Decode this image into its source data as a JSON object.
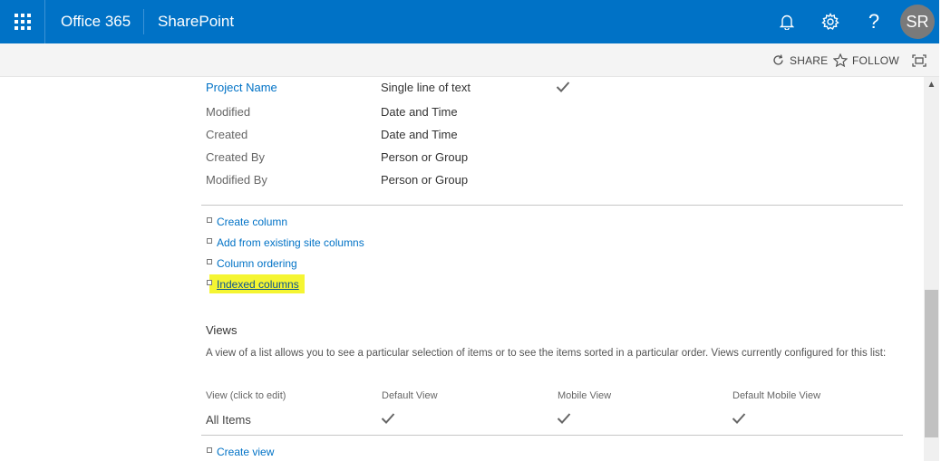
{
  "suite_bar": {
    "brand": "Office 365",
    "app": "SharePoint",
    "avatar_initials": "SR",
    "icons": [
      "app-launcher-icon",
      "bell-icon",
      "gear-icon",
      "help-icon"
    ],
    "accent": "#0072c6"
  },
  "action_bar": {
    "share": "SHARE",
    "follow": "FOLLOW"
  },
  "columns": [
    {
      "name": "Project Name",
      "type": "Single line of text",
      "required": true,
      "link": true
    },
    {
      "name": "Modified",
      "type": "Date and Time",
      "required": false,
      "link": false
    },
    {
      "name": "Created",
      "type": "Date and Time",
      "required": false,
      "link": false
    },
    {
      "name": "Created By",
      "type": "Person or Group",
      "required": false,
      "link": false
    },
    {
      "name": "Modified By",
      "type": "Person or Group",
      "required": false,
      "link": false
    }
  ],
  "column_links": [
    "Create column",
    "Add from existing site columns",
    "Column ordering",
    "Indexed columns"
  ],
  "views": {
    "heading": "Views",
    "description": "A view of a list allows you to see a particular selection of items or to see the items sorted in a particular order. Views currently configured for this list:",
    "headers": [
      "View (click to edit)",
      "Default View",
      "Mobile View",
      "Default Mobile View"
    ],
    "rows": [
      {
        "name": "All Items",
        "default_view": true,
        "mobile_view": true,
        "default_mobile_view": true
      }
    ],
    "create_link": "Create view"
  },
  "highlight_color": "#f5f532"
}
